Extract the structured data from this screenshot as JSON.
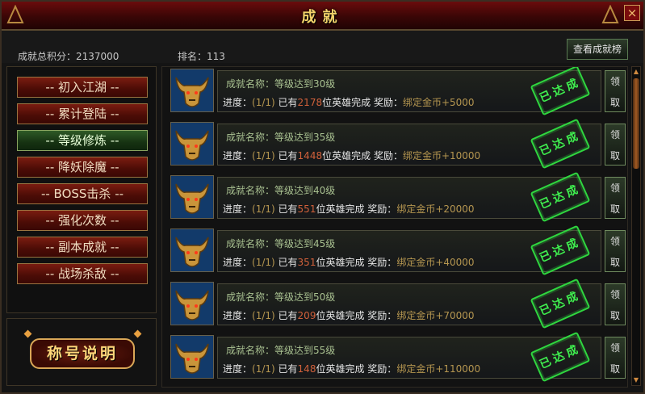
{
  "window": {
    "title": "成就",
    "close_label": "×"
  },
  "stats": {
    "total_score": "成就总积分：2137000",
    "rank": "排名：113",
    "view_button": "查看成就榜"
  },
  "sidebar": {
    "categories": [
      {
        "label": "-- 初入江湖 --"
      },
      {
        "label": "-- 累计登陆 --"
      },
      {
        "label": "-- 等级修炼 --"
      },
      {
        "label": "-- 降妖除魔 --"
      },
      {
        "label": "-- BOSS击杀 --"
      },
      {
        "label": "-- 强化次数 --"
      },
      {
        "label": "-- 副本成就 --"
      },
      {
        "label": "-- 战场杀敌 --"
      }
    ],
    "active_index": 2,
    "explain_button": "称号说明"
  },
  "achievements": [
    {
      "name": "成就名称：等级达到30级",
      "progress_label": "进度：",
      "progress": "(1/1)",
      "heroes_prefix": "已有",
      "heroes_count": "2178",
      "heroes_suffix": "位英雄完成",
      "reward_label": "奖励：",
      "reward": "绑定金币+5000",
      "stamp": "已达成",
      "claim_top": "领",
      "claim_bottom": "取"
    },
    {
      "name": "成就名称：等级达到35级",
      "progress_label": "进度：",
      "progress": "(1/1)",
      "heroes_prefix": "已有",
      "heroes_count": "1448",
      "heroes_suffix": "位英雄完成",
      "reward_label": "奖励：",
      "reward": "绑定金币+10000",
      "stamp": "已达成",
      "claim_top": "领",
      "claim_bottom": "取"
    },
    {
      "name": "成就名称：等级达到40级",
      "progress_label": "进度：",
      "progress": "(1/1)",
      "heroes_prefix": "已有",
      "heroes_count": "551",
      "heroes_suffix": "位英雄完成",
      "reward_label": "奖励：",
      "reward": "绑定金币+20000",
      "stamp": "已达成",
      "claim_top": "领",
      "claim_bottom": "取"
    },
    {
      "name": "成就名称：等级达到45级",
      "progress_label": "进度：",
      "progress": "(1/1)",
      "heroes_prefix": "已有",
      "heroes_count": "351",
      "heroes_suffix": "位英雄完成",
      "reward_label": "奖励：",
      "reward": "绑定金币+40000",
      "stamp": "已达成",
      "claim_top": "领",
      "claim_bottom": "取"
    },
    {
      "name": "成就名称：等级达到50级",
      "progress_label": "进度：",
      "progress": "(1/1)",
      "heroes_prefix": "已有",
      "heroes_count": "209",
      "heroes_suffix": "位英雄完成",
      "reward_label": "奖励：",
      "reward": "绑定金币+70000",
      "stamp": "已达成",
      "claim_top": "领",
      "claim_bottom": "取"
    },
    {
      "name": "成就名称：等级达到55级",
      "progress_label": "进度：",
      "progress": "(1/1)",
      "heroes_prefix": "已有",
      "heroes_count": "148",
      "heroes_suffix": "位英雄完成",
      "reward_label": "奖励：",
      "reward": "绑定金币+110000",
      "stamp": "已达成",
      "claim_top": "领",
      "claim_bottom": "取"
    }
  ],
  "icons": {
    "achievement": "bull-head-icon",
    "close": "close-icon"
  },
  "colors": {
    "title_gold": "#f3d36a",
    "stamp_green": "#3ff04f",
    "count_red": "#d0603a",
    "reward_gold": "#b59650"
  }
}
